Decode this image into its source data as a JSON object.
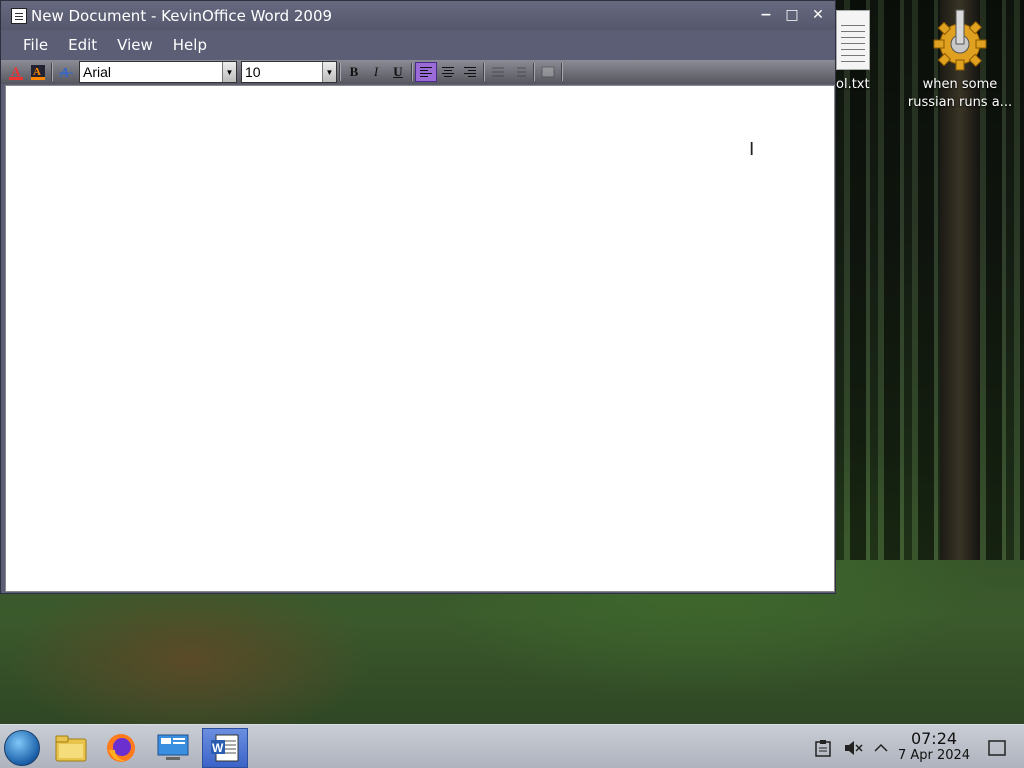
{
  "window": {
    "title": "New Document - KevinOffice Word 2009",
    "controls": {
      "minimize": "−",
      "maximize": "□",
      "close": "✕"
    }
  },
  "menu": [
    "File",
    "Edit",
    "View",
    "Help"
  ],
  "toolbar": {
    "font_name": "Arial",
    "font_size": "10",
    "bold_label": "B",
    "italic_label": "I",
    "underline_label": "U",
    "active_alignment": "align-left"
  },
  "document": {
    "text": ""
  },
  "desktop": {
    "icons": [
      {
        "label": "ol.txt",
        "icon": "text-file-icon"
      },
      {
        "label": "when some russian runs a...",
        "icon": "gear-icon"
      }
    ]
  },
  "taskbar": {
    "apps": [
      "start-orb-icon",
      "file-manager-icon",
      "firefox-icon",
      "remote-desktop-icon",
      "word-icon"
    ],
    "active_app": "word-icon",
    "time": "07:24",
    "date": "7 Apr 2024"
  },
  "colors": {
    "window_chrome": "#5b5e75",
    "taskbar_active": "#3c64c8",
    "align_active": "#9b6bd8"
  }
}
